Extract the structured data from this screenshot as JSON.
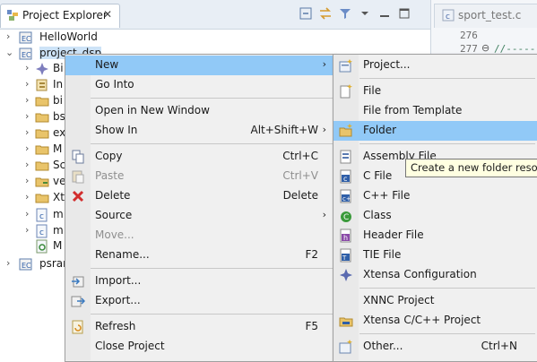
{
  "explorer": {
    "tab_label": "Project Explorer",
    "tab_close": "✕",
    "tree": [
      {
        "label": "HelloWorld",
        "expanded": false
      },
      {
        "label": "project_dsp",
        "expanded": true,
        "selected": true
      },
      {
        "label": "Bi"
      },
      {
        "label": "In"
      },
      {
        "label": "bi"
      },
      {
        "label": "bs"
      },
      {
        "label": "ex"
      },
      {
        "label": "M"
      },
      {
        "label": "Sc"
      },
      {
        "label": "ve"
      },
      {
        "label": "Xt"
      },
      {
        "label": "m"
      },
      {
        "label": "m"
      },
      {
        "label": "M"
      },
      {
        "label": "psran"
      }
    ]
  },
  "editor": {
    "tab_label": "sport_test.c",
    "lines": [
      {
        "num": "276"
      },
      {
        "num": "277",
        "collapse": "⊖",
        "text": "//------"
      }
    ]
  },
  "context_menu": {
    "items": [
      {
        "label": "New",
        "submenu_arrow": "›",
        "highlighted": true
      },
      {
        "label": "Go Into"
      },
      {
        "label": "Open in New Window"
      },
      {
        "label": "Show In",
        "shortcut": "Alt+Shift+W",
        "submenu_arrow": "›"
      },
      {
        "label": "Copy",
        "shortcut": "Ctrl+C"
      },
      {
        "label": "Paste",
        "shortcut": "Ctrl+V",
        "disabled": true
      },
      {
        "label": "Delete",
        "shortcut": "Delete"
      },
      {
        "label": "Source",
        "submenu_arrow": "›"
      },
      {
        "label": "Move...",
        "disabled": true
      },
      {
        "label": "Rename...",
        "shortcut": "F2"
      },
      {
        "label": "Import..."
      },
      {
        "label": "Export..."
      },
      {
        "label": "Refresh",
        "shortcut": "F5"
      },
      {
        "label": "Close Project"
      }
    ]
  },
  "new_submenu": {
    "items": [
      {
        "label": "Project..."
      },
      {
        "label": "File"
      },
      {
        "label": "File from Template"
      },
      {
        "label": "Folder",
        "highlighted": true
      },
      {
        "label": "Assembly File"
      },
      {
        "label": "C File"
      },
      {
        "label": "C++ File"
      },
      {
        "label": "Class"
      },
      {
        "label": "Header File"
      },
      {
        "label": "TIE File"
      },
      {
        "label": "Xtensa Configuration"
      },
      {
        "label": "XNNC Project"
      },
      {
        "label": "Xtensa C/C++ Project"
      },
      {
        "label": "Other...",
        "shortcut": "Ctrl+N"
      }
    ]
  },
  "tooltip": {
    "text": "Create a new folder resource"
  },
  "colors": {
    "highlight": "#91c9f7",
    "selection": "#cde3f7",
    "menu_bg": "#f0f0f0",
    "comment": "#3f7f5f"
  }
}
